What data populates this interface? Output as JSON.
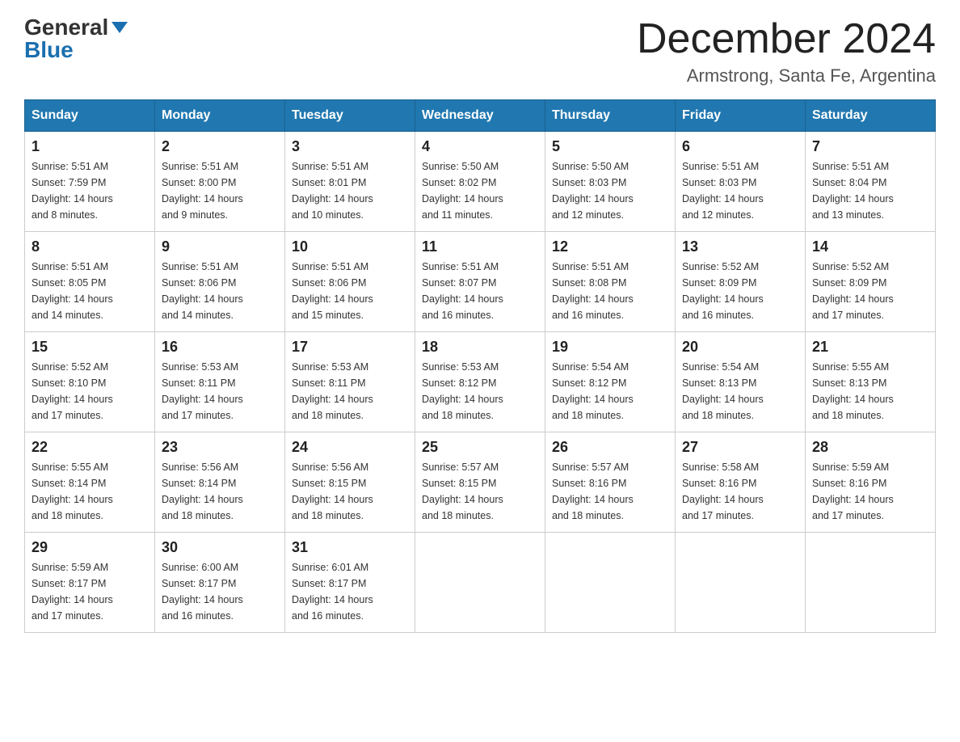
{
  "header": {
    "logo_general": "General",
    "logo_blue": "Blue",
    "month_title": "December 2024",
    "location": "Armstrong, Santa Fe, Argentina"
  },
  "weekdays": [
    "Sunday",
    "Monday",
    "Tuesday",
    "Wednesday",
    "Thursday",
    "Friday",
    "Saturday"
  ],
  "weeks": [
    [
      {
        "day": "1",
        "sunrise": "5:51 AM",
        "sunset": "7:59 PM",
        "daylight": "14 hours and 8 minutes."
      },
      {
        "day": "2",
        "sunrise": "5:51 AM",
        "sunset": "8:00 PM",
        "daylight": "14 hours and 9 minutes."
      },
      {
        "day": "3",
        "sunrise": "5:51 AM",
        "sunset": "8:01 PM",
        "daylight": "14 hours and 10 minutes."
      },
      {
        "day": "4",
        "sunrise": "5:50 AM",
        "sunset": "8:02 PM",
        "daylight": "14 hours and 11 minutes."
      },
      {
        "day": "5",
        "sunrise": "5:50 AM",
        "sunset": "8:03 PM",
        "daylight": "14 hours and 12 minutes."
      },
      {
        "day": "6",
        "sunrise": "5:51 AM",
        "sunset": "8:03 PM",
        "daylight": "14 hours and 12 minutes."
      },
      {
        "day": "7",
        "sunrise": "5:51 AM",
        "sunset": "8:04 PM",
        "daylight": "14 hours and 13 minutes."
      }
    ],
    [
      {
        "day": "8",
        "sunrise": "5:51 AM",
        "sunset": "8:05 PM",
        "daylight": "14 hours and 14 minutes."
      },
      {
        "day": "9",
        "sunrise": "5:51 AM",
        "sunset": "8:06 PM",
        "daylight": "14 hours and 14 minutes."
      },
      {
        "day": "10",
        "sunrise": "5:51 AM",
        "sunset": "8:06 PM",
        "daylight": "14 hours and 15 minutes."
      },
      {
        "day": "11",
        "sunrise": "5:51 AM",
        "sunset": "8:07 PM",
        "daylight": "14 hours and 16 minutes."
      },
      {
        "day": "12",
        "sunrise": "5:51 AM",
        "sunset": "8:08 PM",
        "daylight": "14 hours and 16 minutes."
      },
      {
        "day": "13",
        "sunrise": "5:52 AM",
        "sunset": "8:09 PM",
        "daylight": "14 hours and 16 minutes."
      },
      {
        "day": "14",
        "sunrise": "5:52 AM",
        "sunset": "8:09 PM",
        "daylight": "14 hours and 17 minutes."
      }
    ],
    [
      {
        "day": "15",
        "sunrise": "5:52 AM",
        "sunset": "8:10 PM",
        "daylight": "14 hours and 17 minutes."
      },
      {
        "day": "16",
        "sunrise": "5:53 AM",
        "sunset": "8:11 PM",
        "daylight": "14 hours and 17 minutes."
      },
      {
        "day": "17",
        "sunrise": "5:53 AM",
        "sunset": "8:11 PM",
        "daylight": "14 hours and 18 minutes."
      },
      {
        "day": "18",
        "sunrise": "5:53 AM",
        "sunset": "8:12 PM",
        "daylight": "14 hours and 18 minutes."
      },
      {
        "day": "19",
        "sunrise": "5:54 AM",
        "sunset": "8:12 PM",
        "daylight": "14 hours and 18 minutes."
      },
      {
        "day": "20",
        "sunrise": "5:54 AM",
        "sunset": "8:13 PM",
        "daylight": "14 hours and 18 minutes."
      },
      {
        "day": "21",
        "sunrise": "5:55 AM",
        "sunset": "8:13 PM",
        "daylight": "14 hours and 18 minutes."
      }
    ],
    [
      {
        "day": "22",
        "sunrise": "5:55 AM",
        "sunset": "8:14 PM",
        "daylight": "14 hours and 18 minutes."
      },
      {
        "day": "23",
        "sunrise": "5:56 AM",
        "sunset": "8:14 PM",
        "daylight": "14 hours and 18 minutes."
      },
      {
        "day": "24",
        "sunrise": "5:56 AM",
        "sunset": "8:15 PM",
        "daylight": "14 hours and 18 minutes."
      },
      {
        "day": "25",
        "sunrise": "5:57 AM",
        "sunset": "8:15 PM",
        "daylight": "14 hours and 18 minutes."
      },
      {
        "day": "26",
        "sunrise": "5:57 AM",
        "sunset": "8:16 PM",
        "daylight": "14 hours and 18 minutes."
      },
      {
        "day": "27",
        "sunrise": "5:58 AM",
        "sunset": "8:16 PM",
        "daylight": "14 hours and 17 minutes."
      },
      {
        "day": "28",
        "sunrise": "5:59 AM",
        "sunset": "8:16 PM",
        "daylight": "14 hours and 17 minutes."
      }
    ],
    [
      {
        "day": "29",
        "sunrise": "5:59 AM",
        "sunset": "8:17 PM",
        "daylight": "14 hours and 17 minutes."
      },
      {
        "day": "30",
        "sunrise": "6:00 AM",
        "sunset": "8:17 PM",
        "daylight": "14 hours and 16 minutes."
      },
      {
        "day": "31",
        "sunrise": "6:01 AM",
        "sunset": "8:17 PM",
        "daylight": "14 hours and 16 minutes."
      },
      null,
      null,
      null,
      null
    ]
  ],
  "labels": {
    "sunrise": "Sunrise:",
    "sunset": "Sunset:",
    "daylight": "Daylight:"
  }
}
